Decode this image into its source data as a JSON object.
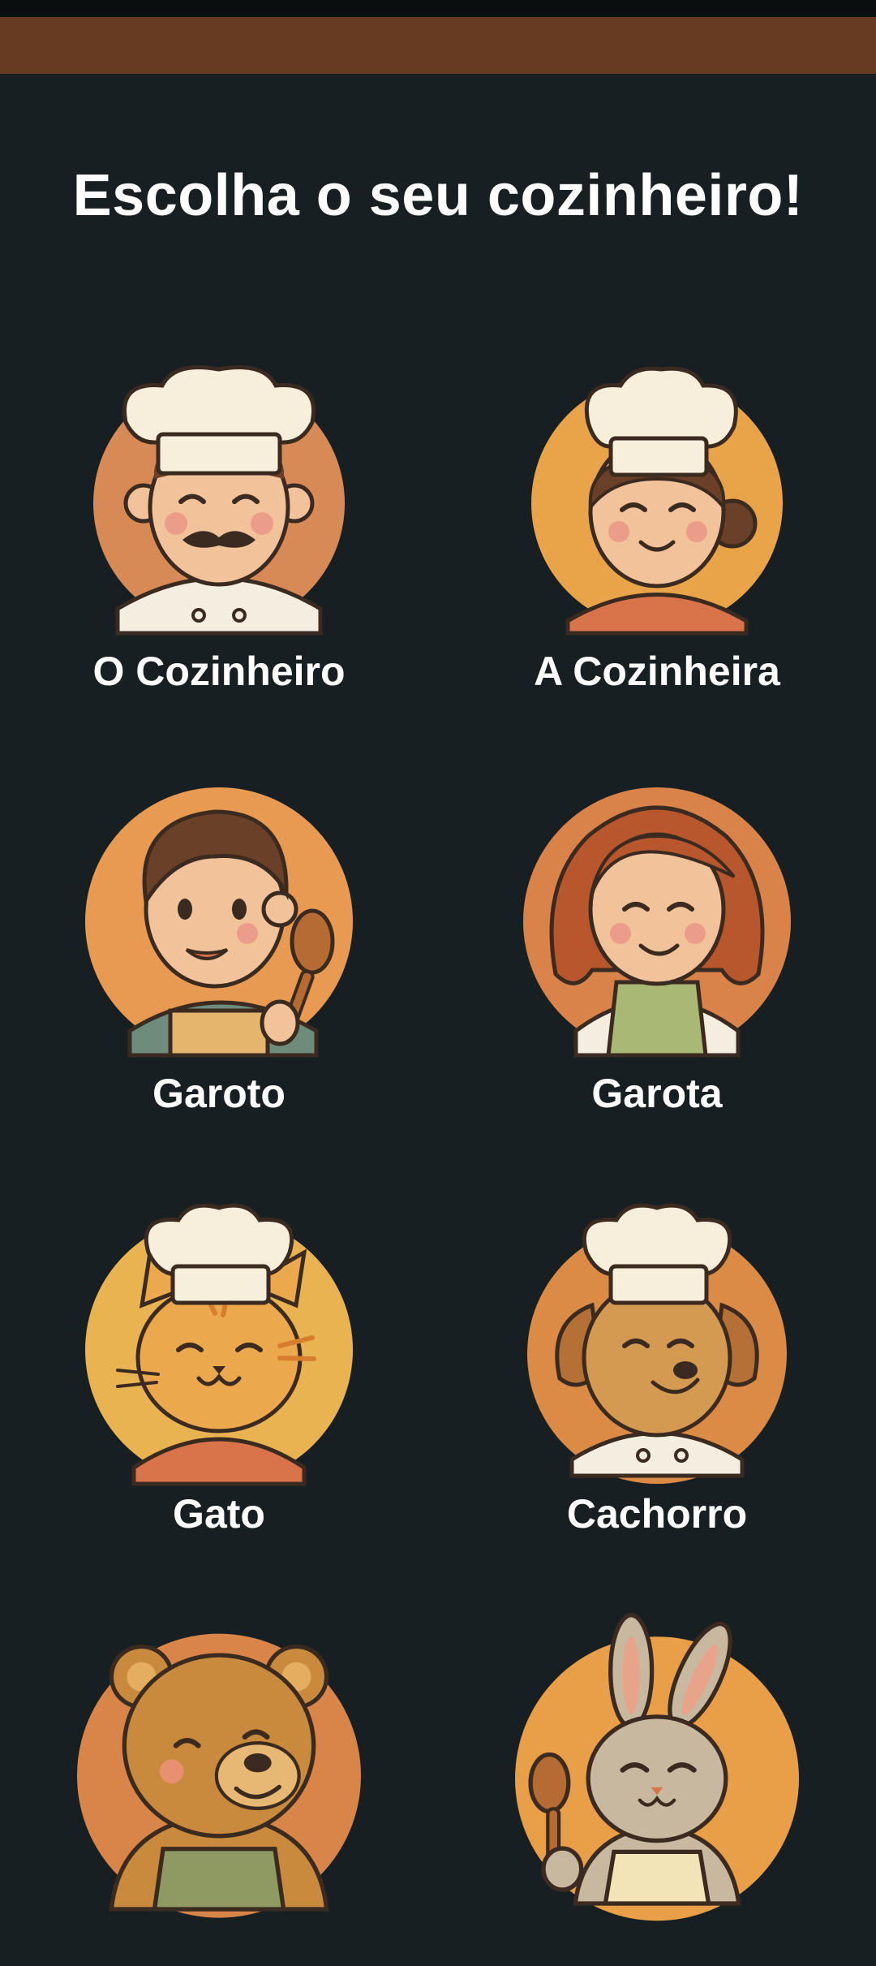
{
  "page": {
    "title": "Escolha o seu cozinheiro!"
  },
  "colors": {
    "background": "#171f22",
    "app_bar": "#673a22",
    "status_bar": "#0a0e0f",
    "text": "#ffffff"
  },
  "chefs": [
    {
      "label": "O Cozinheiro",
      "icon": "male-chef-icon"
    },
    {
      "label": "A Cozinheira",
      "icon": "female-chef-icon"
    },
    {
      "label": "Garoto",
      "icon": "boy-icon"
    },
    {
      "label": "Garota",
      "icon": "girl-icon"
    },
    {
      "label": "Gato",
      "icon": "cat-chef-icon"
    },
    {
      "label": "Cachorro",
      "icon": "dog-chef-icon"
    },
    {
      "label": "",
      "icon": "bear-icon"
    },
    {
      "label": "",
      "icon": "bunny-icon"
    }
  ]
}
